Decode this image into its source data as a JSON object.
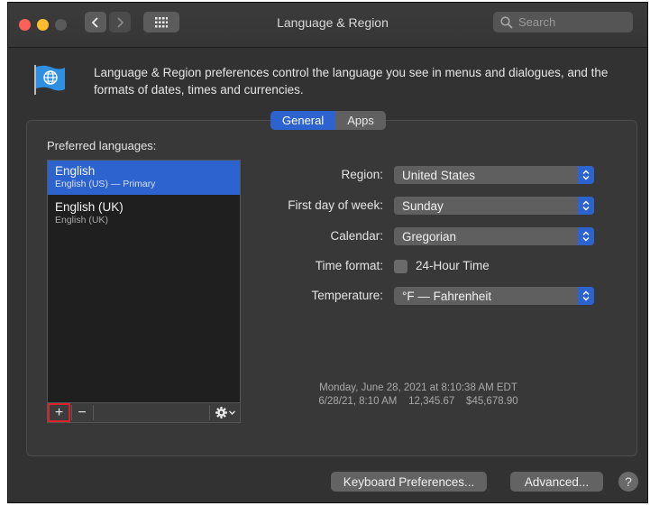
{
  "window": {
    "title": "Language & Region"
  },
  "search": {
    "placeholder": "Search"
  },
  "intro": {
    "text": "Language & Region preferences control the language you see in menus and dialogues, and the formats of dates, times and currencies."
  },
  "tabs": [
    {
      "label": "General",
      "selected": true
    },
    {
      "label": "Apps",
      "selected": false
    }
  ],
  "languages": {
    "header": "Preferred languages:",
    "items": [
      {
        "name": "English",
        "detail": "English (US) — Primary",
        "selected": true
      },
      {
        "name": "English (UK)",
        "detail": "English (UK)",
        "selected": false
      }
    ],
    "add_label": "+",
    "remove_label": "−"
  },
  "settings": {
    "region_label": "Region:",
    "region_value": "United States",
    "first_day_label": "First day of week:",
    "first_day_value": "Sunday",
    "calendar_label": "Calendar:",
    "calendar_value": "Gregorian",
    "time_format_label": "Time format:",
    "time_format_option": "24-Hour Time",
    "time_format_checked": false,
    "temperature_label": "Temperature:",
    "temperature_value": "°F — Fahrenheit"
  },
  "sample": {
    "line1": "Monday, June 28, 2021 at 8:10:38 AM EDT",
    "line2": "6/28/21, 8:10 AM    12,345.67    $45,678.90"
  },
  "buttons": {
    "keyboard": "Keyboard Preferences...",
    "advanced": "Advanced...",
    "help": "?"
  },
  "colors": {
    "accent": "#2c63cf",
    "close": "#fe5f57",
    "minimize": "#febc2e",
    "disabled": "#5a5a5a",
    "highlight": "#d8232a"
  },
  "icons": {
    "back": "chevron-left-icon",
    "forward": "chevron-right-icon",
    "grid": "grid-icon",
    "search": "search-icon",
    "flag": "globe-flag-icon",
    "gear": "gear-icon"
  }
}
